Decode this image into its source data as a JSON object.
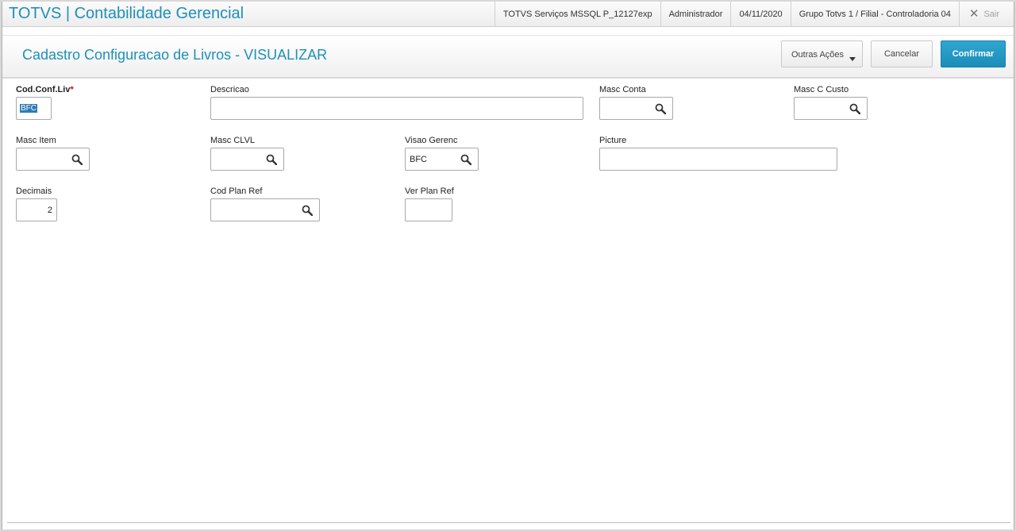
{
  "topbar": {
    "app_title": "TOTVS | Contabilidade Gerencial",
    "environment": "TOTVS Serviços MSSQL P_12127exp",
    "user": "Administrador",
    "date": "04/11/2020",
    "branch": "Grupo Totvs 1 / Filial - Controladoria 04",
    "exit_label": "Sair"
  },
  "header": {
    "title": "Cadastro Configuracao de Livros - VISUALIZAR",
    "buttons": {
      "other_actions": "Outras Ações",
      "cancel": "Cancelar",
      "confirm": "Confirmar"
    }
  },
  "form": {
    "cod_conf_liv": {
      "label": "Cod.Conf.Liv",
      "required_mark": "*",
      "value": "BFC"
    },
    "descricao": {
      "label": "Descricao",
      "value": ""
    },
    "masc_conta": {
      "label": "Masc Conta",
      "value": ""
    },
    "masc_c_custo": {
      "label": "Masc C Custo",
      "value": ""
    },
    "masc_item": {
      "label": "Masc Item",
      "value": ""
    },
    "masc_clvl": {
      "label": "Masc CLVL",
      "value": ""
    },
    "visao_gerenc": {
      "label": "Visao Gerenc",
      "value": "BFC"
    },
    "picture": {
      "label": "Picture",
      "value": ""
    },
    "decimais": {
      "label": "Decimais",
      "value": "2"
    },
    "cod_plan_ref": {
      "label": "Cod Plan Ref",
      "value": ""
    },
    "ver_plan_ref": {
      "label": "Ver Plan Ref",
      "value": ""
    }
  },
  "colors": {
    "accent": "#1e90b8",
    "confirm_button": "#1a8db8",
    "required_star": "#dd0000"
  },
  "icons": {
    "lookup": "search-icon",
    "exit": "close-icon",
    "dropdown": "caret-down-icon"
  }
}
